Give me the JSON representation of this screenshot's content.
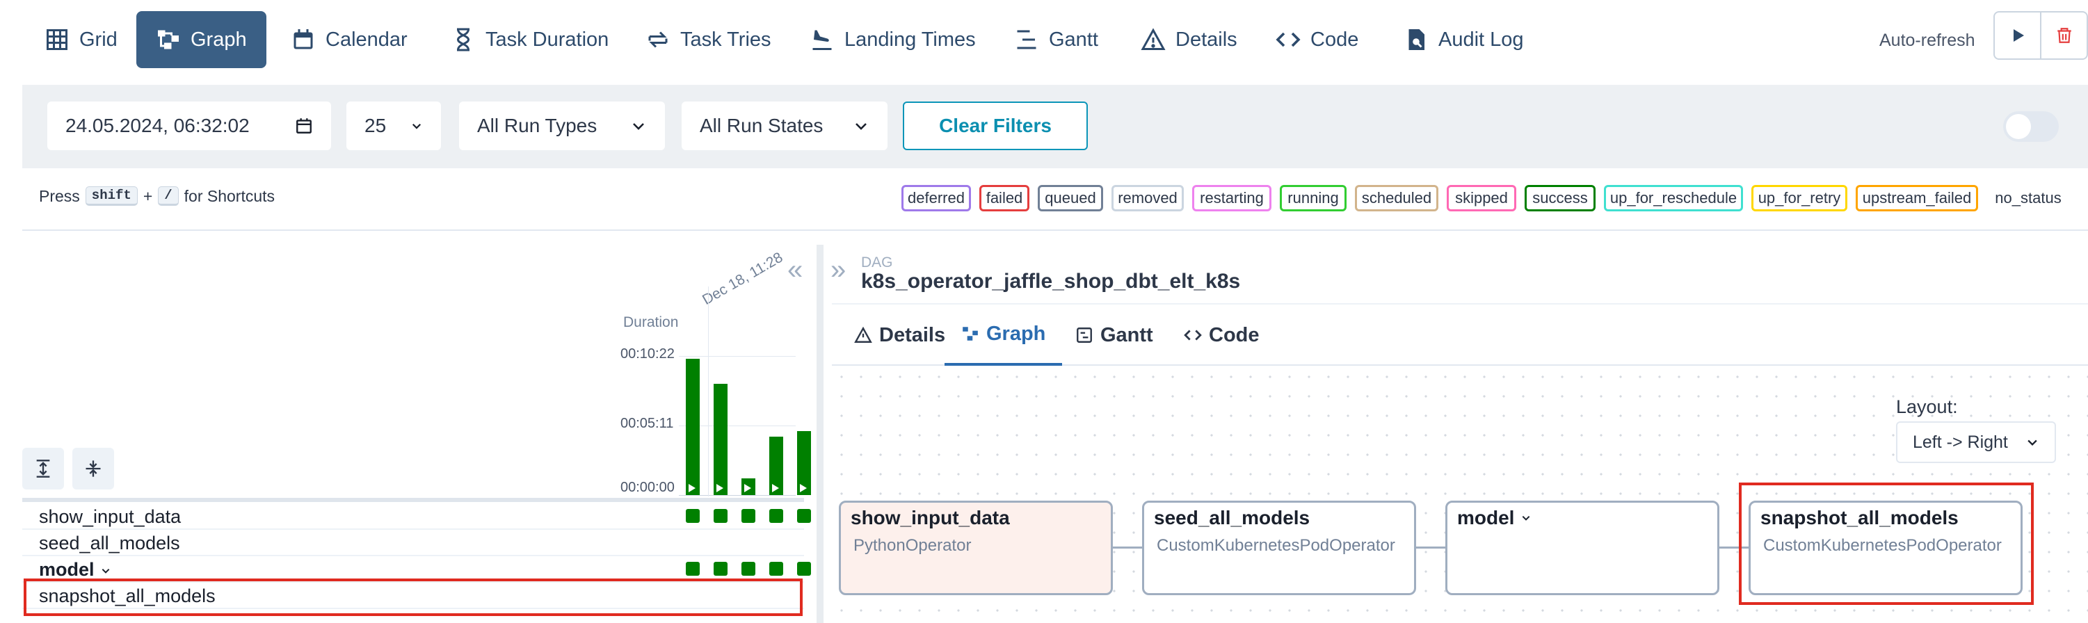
{
  "nav": {
    "items": [
      {
        "label": "Grid",
        "icon": "grid-icon"
      },
      {
        "label": "Graph",
        "icon": "graph-icon",
        "active": true
      },
      {
        "label": "Calendar",
        "icon": "calendar-icon"
      },
      {
        "label": "Task Duration",
        "icon": "hourglass-icon"
      },
      {
        "label": "Task Tries",
        "icon": "retry-arrows-icon"
      },
      {
        "label": "Landing Times",
        "icon": "plane-landing-icon"
      },
      {
        "label": "Gantt",
        "icon": "gantt-icon"
      },
      {
        "label": "Details",
        "icon": "warning-triangle-icon"
      },
      {
        "label": "Code",
        "icon": "code-icon"
      },
      {
        "label": "Audit Log",
        "icon": "file-search-icon"
      }
    ],
    "active_color": "#3a5f85"
  },
  "filters": {
    "datetime": "24.05.2024, 06:32:02",
    "num_runs": "25",
    "run_type": "All Run Types",
    "run_state": "All Run States",
    "clear_label": "Clear Filters",
    "auto_refresh_label": "Auto-refresh",
    "auto_refresh_on": false
  },
  "shortcuts": {
    "press": "Press",
    "key1": "shift",
    "plus": "+",
    "key2": "/",
    "suffix": "for Shortcuts"
  },
  "legend": [
    {
      "label": "deferred",
      "color": "#9f7aea"
    },
    {
      "label": "failed",
      "color": "#e53e3e"
    },
    {
      "label": "queued",
      "color": "#718096"
    },
    {
      "label": "removed",
      "color": "#cbd5e0"
    },
    {
      "label": "restarting",
      "color": "#ee82ee"
    },
    {
      "label": "running",
      "color": "#32cd32"
    },
    {
      "label": "scheduled",
      "color": "#d2b48c"
    },
    {
      "label": "skipped",
      "color": "#ff69b4"
    },
    {
      "label": "success",
      "color": "#008000"
    },
    {
      "label": "up_for_reschedule",
      "color": "#40e0d0"
    },
    {
      "label": "up_for_retry",
      "color": "#ffd700"
    },
    {
      "label": "upstream_failed",
      "color": "#ffa500"
    },
    {
      "label": "no_status",
      "color": null
    }
  ],
  "grid": {
    "duration_label": "Duration",
    "run_label": "Dec 18, 11:28",
    "ticks": [
      "00:10:22",
      "00:05:11",
      "00:00:00"
    ],
    "run_durations_fraction": [
      0.98,
      0.8,
      0.12,
      0.42,
      0.46
    ],
    "tasks": [
      {
        "name": "show_input_data",
        "bold": false,
        "cells": 5
      },
      {
        "name": "seed_all_models",
        "bold": false,
        "cells": 0
      },
      {
        "name": "model",
        "bold": true,
        "cells": 5,
        "expandable": true
      },
      {
        "name": "snapshot_all_models",
        "bold": false,
        "cells": 0,
        "highlighted": true
      }
    ]
  },
  "dag": {
    "label": "DAG",
    "name": "k8s_operator_jaffle_shop_dbt_elt_k8s"
  },
  "tabs": [
    {
      "label": "Details",
      "icon": "warning-triangle-icon"
    },
    {
      "label": "Graph",
      "icon": "graph-icon",
      "active": true
    },
    {
      "label": "Gantt",
      "icon": "gantt-icon"
    },
    {
      "label": "Code",
      "icon": "code-icon"
    }
  ],
  "graph": {
    "layout_label": "Layout:",
    "layout_value": "Left -> Right",
    "nodes": [
      {
        "title": "show_input_data",
        "operator": "PythonOperator"
      },
      {
        "title": "seed_all_models",
        "operator": "CustomKubernetesPodOperator"
      },
      {
        "title": "model",
        "operator": "",
        "expandable": true
      },
      {
        "title": "snapshot_all_models",
        "operator": "CustomKubernetesPodOperator",
        "highlighted": true
      }
    ]
  },
  "colors": {
    "success": "#008000",
    "highlight": "#e02b20",
    "accent": "#0b95b8"
  }
}
